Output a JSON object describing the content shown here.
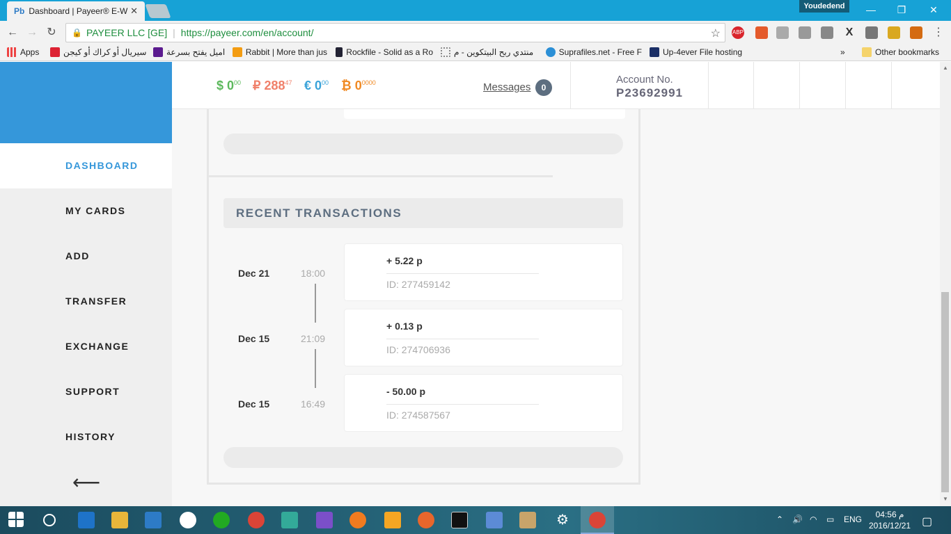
{
  "browser": {
    "tab_favicon": "Pb",
    "tab_title": "Dashboard | Payeer® E-W",
    "tab_close": "✕",
    "profile_name": "Youdedend",
    "omnibox": {
      "org": "PAYEER LLC [GE]",
      "url": "https://payeer.com/en/account/"
    },
    "bookmarks": [
      {
        "label": "Apps",
        "icon": "apps-grid-icon"
      },
      {
        "label": "سيريال أو كراك أو كيجن",
        "icon": "bookmark-icon"
      },
      {
        "label": "اميل يفتح بسرعة",
        "icon": "yahoo-icon"
      },
      {
        "label": "Rabbit | More than jus",
        "icon": "rabbit-icon"
      },
      {
        "label": "Rockfile - Solid as a Ro",
        "icon": "rockfile-icon"
      },
      {
        "label": "منتدي ربح البيتكوين - م",
        "icon": "forum-icon"
      },
      {
        "label": "Suprafiles.net - Free F",
        "icon": "suprafiles-icon"
      },
      {
        "label": "Up-4ever File hosting",
        "icon": "up4ever-icon"
      }
    ],
    "bookmarks_more": "»",
    "other_bookmarks": "Other bookmarks"
  },
  "header": {
    "balances": [
      {
        "symbol": "$",
        "whole": "0",
        "frac": "00",
        "color": "#5cb85c"
      },
      {
        "symbol": "₽",
        "whole": "288",
        "frac": "47",
        "color": "#f0806a"
      },
      {
        "symbol": "€",
        "whole": "0",
        "frac": "00",
        "color": "#3aa3d9"
      },
      {
        "symbol": "₿",
        "whole": "0",
        "frac": "0000",
        "color": "#f08a24"
      }
    ],
    "messages_label": "Messages",
    "messages_count": "0",
    "account_label": "Account No.",
    "account_number": "P23692991"
  },
  "sidebar": {
    "items": [
      {
        "label": "DASHBOARD",
        "active": true
      },
      {
        "label": "MY CARDS"
      },
      {
        "label": "ADD"
      },
      {
        "label": "TRANSFER"
      },
      {
        "label": "EXCHANGE"
      },
      {
        "label": "SUPPORT"
      },
      {
        "label": "HISTORY"
      }
    ],
    "back_arrow": "⟵"
  },
  "recent_transactions": {
    "title": "RECENT TRANSACTIONS",
    "items": [
      {
        "date": "Dec 21",
        "time": "18:00",
        "amount": "+ 5.22 p",
        "id": "ID: 277459142"
      },
      {
        "date": "Dec 15",
        "time": "21:09",
        "amount": "+ 0.13 p",
        "id": "ID: 274706936"
      },
      {
        "date": "Dec 15",
        "time": "16:49",
        "amount": "- 50.00 p",
        "id": "ID: 274587567"
      }
    ]
  },
  "taskbar": {
    "language": "ENG",
    "time": "04:56 م",
    "date": "2016/12/21"
  }
}
